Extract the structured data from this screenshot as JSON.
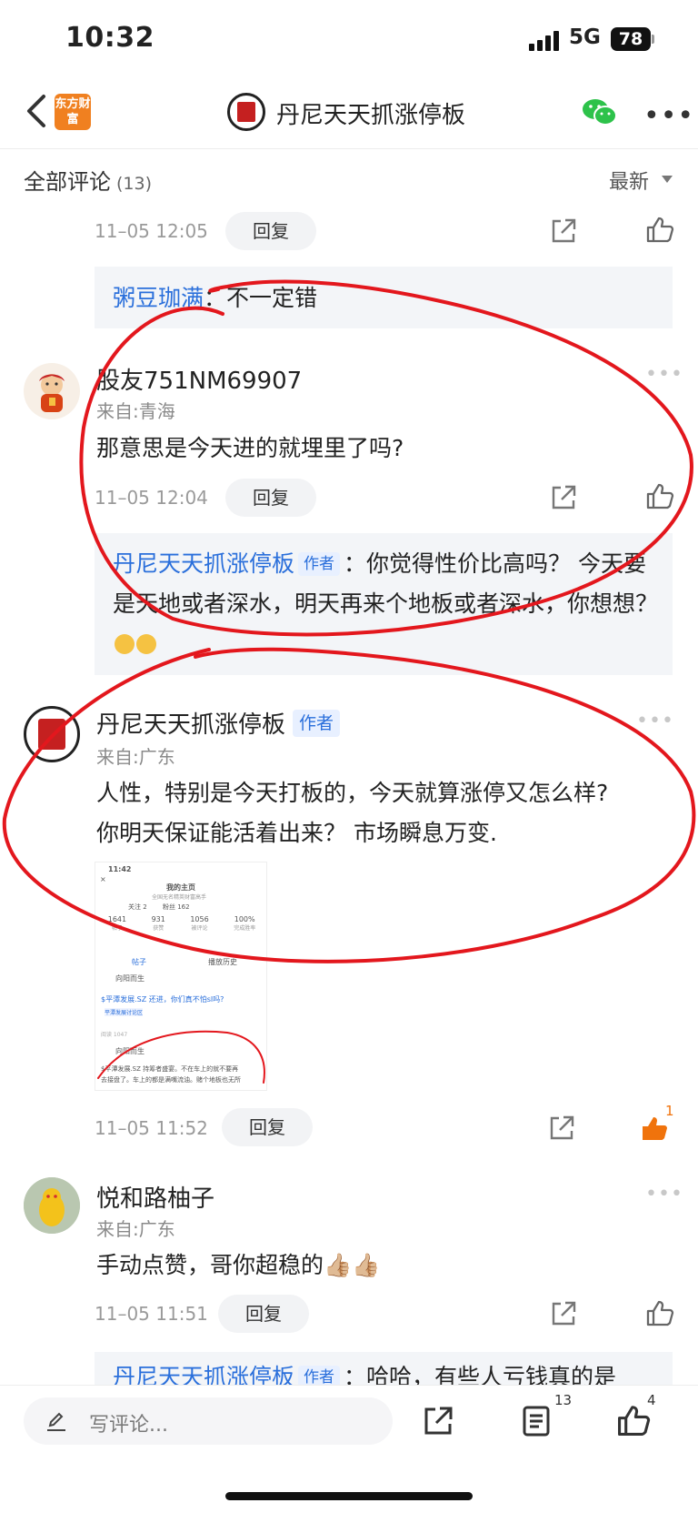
{
  "status_bar": {
    "time": "10:32",
    "network": "5G",
    "battery": "78"
  },
  "nav": {
    "brand_logo_text": "东方财富",
    "title": "丹尼天天抓涨停板"
  },
  "section": {
    "title": "全部评论",
    "count": "(13)",
    "sort_label": "最新"
  },
  "top_meta": {
    "time": "11–05 12:05",
    "reply_label": "回复"
  },
  "top_reply": {
    "name": "粥豆珈满",
    "text": "：不一定错"
  },
  "comments": [
    {
      "name": "股友751NM69907",
      "from": "来自:青海",
      "text": "那意思是今天进的就埋里了吗?",
      "time": "11–05 12:04",
      "reply_label": "回复",
      "reply": {
        "name": "丹尼天天抓涨停板",
        "tag": "作者",
        "text": "：你觉得性价比高吗？ 今天要是天地或者深水，明天再来个地板或者深水，你想想？"
      }
    },
    {
      "name": "丹尼天天抓涨停板",
      "tag": "作者",
      "from": "来自:广东",
      "text_line1": "人性，特别是今天打板的，今天就算涨停又怎么样?",
      "text_line2": "你明天保证能活着出来？ 市场瞬息万变.",
      "time": "11–05 11:52",
      "reply_label": "回复",
      "like_count": "1"
    },
    {
      "name": "悦和路柚子",
      "from": "来自:广东",
      "text": "手动点赞，哥你超稳的👍🏼👍🏼",
      "time": "11–05 11:51",
      "reply_label": "回复",
      "reply": {
        "name": "丹尼天天抓涨停板",
        "tag": "作者",
        "text": "：哈哈，有些人亏钱真的是"
      }
    }
  ],
  "thumbnail": {
    "time": "11:42",
    "title": "我的主页",
    "subtitle": "全国无名精英财富高手",
    "follow": "关注 2",
    "fans": "粉丝 162",
    "stats": [
      {
        "value": "1641",
        "label": "帖子"
      },
      {
        "value": "931",
        "label": "获赞"
      },
      {
        "value": "1056",
        "label": "被评论"
      },
      {
        "value": "100%",
        "label": "完成胜率"
      }
    ],
    "tab1": "帖子",
    "tab2": "播放历史",
    "user1": "向阳而生",
    "post1": "$平潭发展.SZ 还进，你们真不怕sl吗?",
    "post1_tag": "平潭发展讨论区",
    "post1_reads": "阅读 1047",
    "user2": "向阳而生",
    "post2_line1": "$平潭发展.SZ 持筹者盛宴。不在车上的就不要再",
    "post2_line2": "去接盘了。车上的都是满嘴流油。赌个地板也无所"
  },
  "bottom_bar": {
    "placeholder": "写评论...",
    "comment_count": "13",
    "like_count": "4"
  },
  "colors": {
    "link_blue": "#2a6fdb",
    "annotation_red": "#e3171d",
    "like_orange": "#f0730c"
  }
}
